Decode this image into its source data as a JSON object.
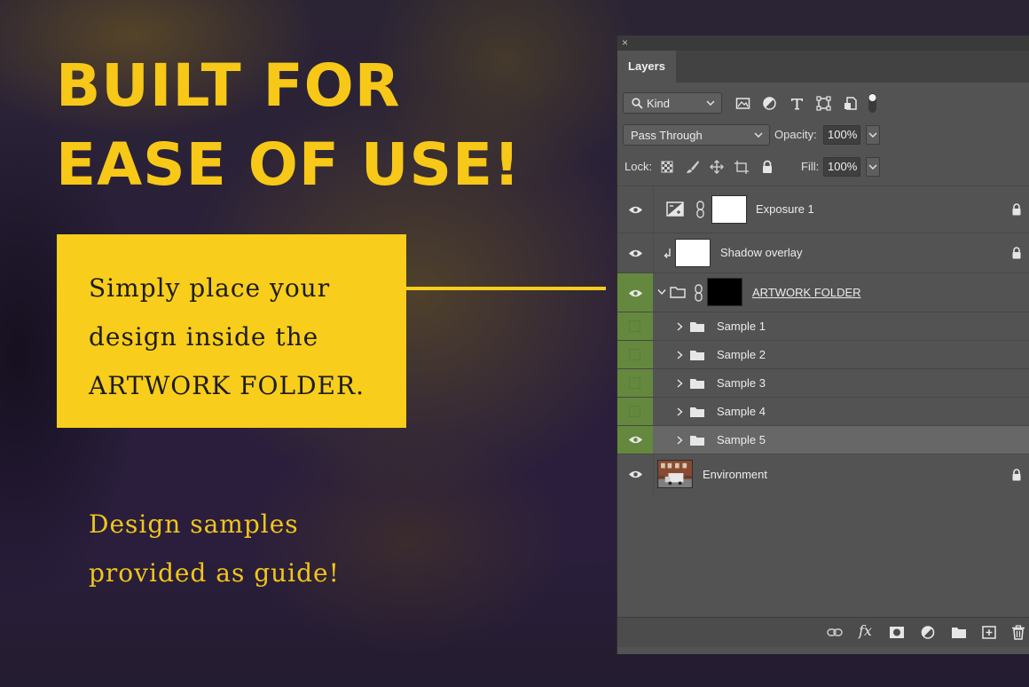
{
  "promo": {
    "headline_line1": "BUILT FOR",
    "headline_line2": "EASE OF USE!",
    "callout_text": "Simply place your\ndesign inside the\nARTWORK FOLDER.",
    "samples_note": "Design samples\nprovided as guide!",
    "accent_color": "#f8cd1b"
  },
  "panel": {
    "close_glyph": "×",
    "tab_label": "Layers",
    "filter": {
      "kind_label": "Kind",
      "icons": [
        "image-filter-icon",
        "adjustment-filter-icon",
        "type-filter-icon",
        "shape-filter-icon",
        "smart-object-filter-icon",
        "filter-toggle-icon"
      ]
    },
    "blend_mode": "Pass Through",
    "opacity_label": "Opacity:",
    "opacity_value": "100%",
    "lock_label": "Lock:",
    "lock_icons": [
      "lock-transparent-icon",
      "lock-image-icon",
      "lock-position-icon",
      "lock-artboard-icon",
      "lock-all-icon"
    ],
    "fill_label": "Fill:",
    "fill_value": "100%",
    "layers": [
      {
        "name": "Exposure 1",
        "type": "adjustment",
        "visible": true,
        "locked": true
      },
      {
        "name": "Shadow overlay",
        "type": "clipped",
        "visible": true,
        "locked": true
      },
      {
        "name": "ARTWORK FOLDER",
        "type": "group-open",
        "visible": true,
        "locked": false
      },
      {
        "name": "Sample 1",
        "type": "group",
        "visible": false,
        "locked": false
      },
      {
        "name": "Sample 2",
        "type": "group",
        "visible": false,
        "locked": false
      },
      {
        "name": "Sample 3",
        "type": "group",
        "visible": false,
        "locked": false
      },
      {
        "name": "Sample 4",
        "type": "group",
        "visible": false,
        "locked": false
      },
      {
        "name": "Sample 5",
        "type": "group",
        "visible": true,
        "locked": false,
        "selected": true
      },
      {
        "name": "Environment",
        "type": "image",
        "visible": true,
        "locked": true
      }
    ],
    "bottom_icons": [
      "link-layers-icon",
      "fx-icon",
      "add-mask-icon",
      "new-adjustment-icon",
      "new-group-icon",
      "new-layer-icon",
      "delete-layer-icon"
    ],
    "fx_glyph": "fx"
  }
}
